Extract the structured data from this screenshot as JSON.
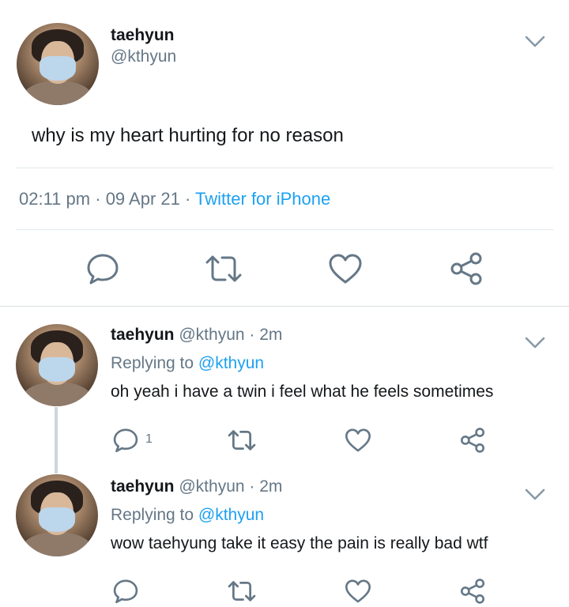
{
  "main_tweet": {
    "display_name": "taehyun",
    "handle": "@kthyun",
    "text": "why is my heart hurting for no reason",
    "time": "02:11 pm",
    "date": "09 Apr 21",
    "source": "Twitter for iPhone"
  },
  "meta_separator": "·",
  "replies": [
    {
      "display_name": "taehyun",
      "handle": "@kthyun",
      "age": "2m",
      "replying_label": "Replying to",
      "replying_to": "@kthyun",
      "text": "oh yeah i have a twin i feel what he feels sometimes",
      "reply_count": "1"
    },
    {
      "display_name": "taehyun",
      "handle": "@kthyun",
      "age": "2m",
      "replying_label": "Replying to",
      "replying_to": "@kthyun",
      "text": "wow taehyung take it easy the pain is really bad wtf"
    }
  ],
  "colors": {
    "accent": "#1da1f2",
    "secondary_text": "#657786",
    "primary_text": "#14171a",
    "divider": "#e1e8ed"
  },
  "icons": [
    "reply-icon",
    "retweet-icon",
    "like-icon",
    "share-icon",
    "chevron-down-icon"
  ]
}
